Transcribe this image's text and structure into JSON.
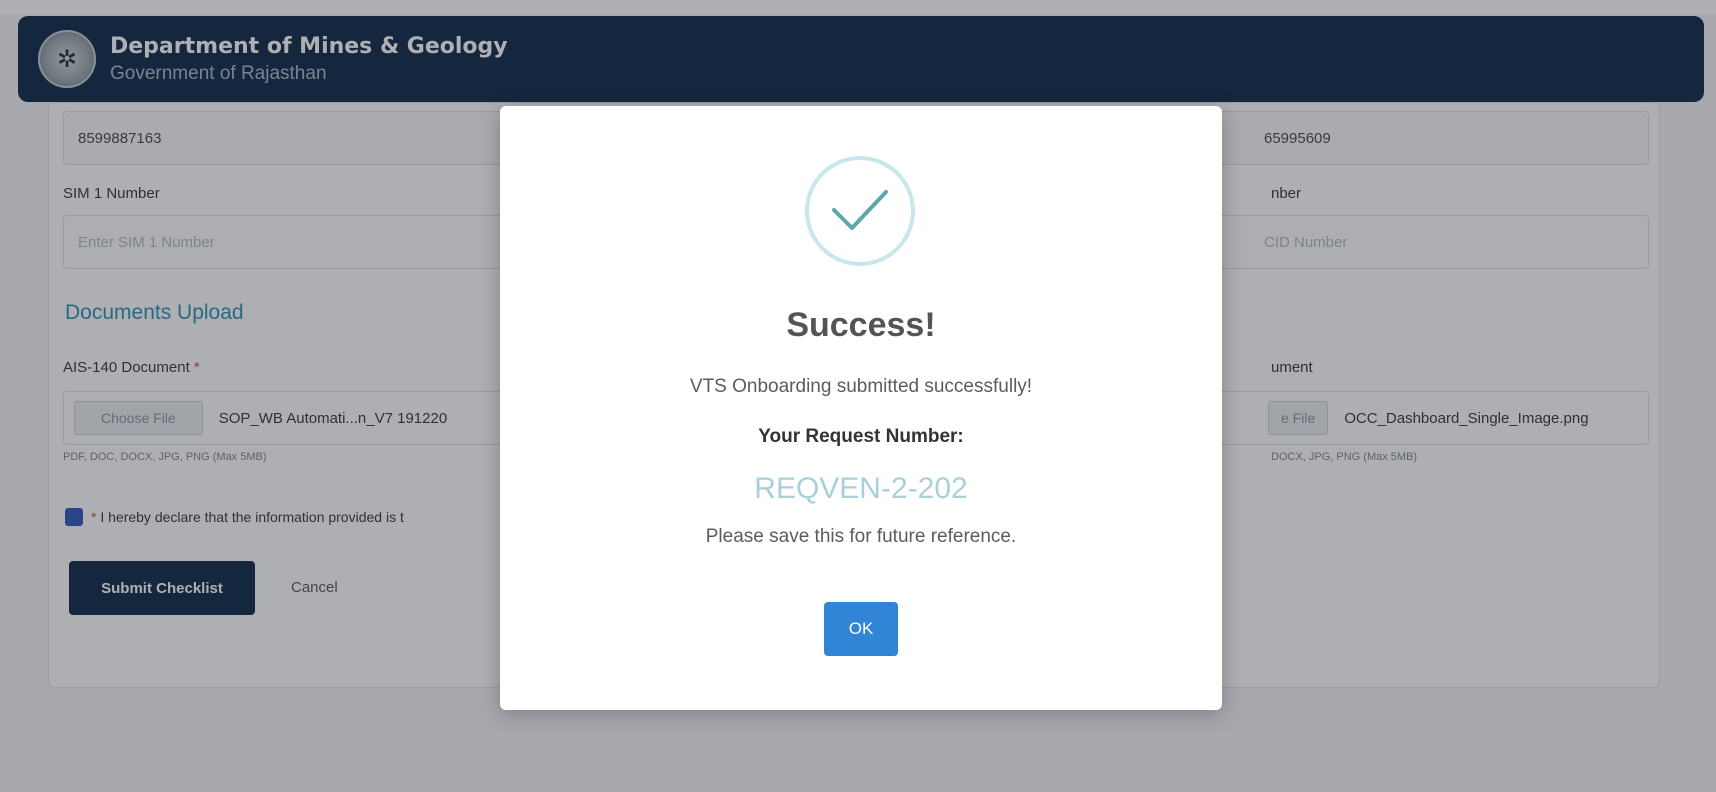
{
  "header": {
    "title": "Department of Mines & Geology",
    "subtitle": "Government of Rajasthan",
    "emblem_icon": "emblem-logo"
  },
  "form": {
    "left": {
      "phone_value": "8599887163",
      "sim1_label": "SIM 1 Number",
      "sim1_placeholder": "Enter SIM 1 Number",
      "ais_label": "AIS-140 Document",
      "ais_required": "*",
      "choose_file": "Choose File",
      "ais_file_name": "SOP_WB Automati...n_V7 191220",
      "file_hint": "PDF, DOC, DOCX, JPG, PNG (Max 5MB)"
    },
    "right": {
      "phone_value_partial": "65995609",
      "label_partial": "nber",
      "placeholder_partial": "CID Number",
      "doc_label_partial": "ument",
      "choose_file_partial": "e File",
      "file_name": "OCC_Dashboard_Single_Image.png",
      "file_hint_partial": "DOCX, JPG, PNG (Max 5MB)"
    },
    "documents_title": "Documents Upload",
    "declaration_required": "*",
    "declaration_text": "I hereby declare that the information provided is t",
    "submit_label": "Submit Checklist",
    "cancel_label": "Cancel"
  },
  "modal": {
    "icon": "check-icon",
    "title": "Success!",
    "message": "VTS Onboarding submitted successfully!",
    "request_label": "Your Request Number:",
    "request_number": "REQVEN-2-202",
    "note": "Please save this for future reference.",
    "ok_label": "OK"
  },
  "colors": {
    "header_bg": "#0b2545",
    "accent": "#2b8db3",
    "ok_button": "#3085d6",
    "request_number": "#a8d0dc",
    "check_ring": "#c9e6ea",
    "check_mark": "#5aa9a8"
  }
}
